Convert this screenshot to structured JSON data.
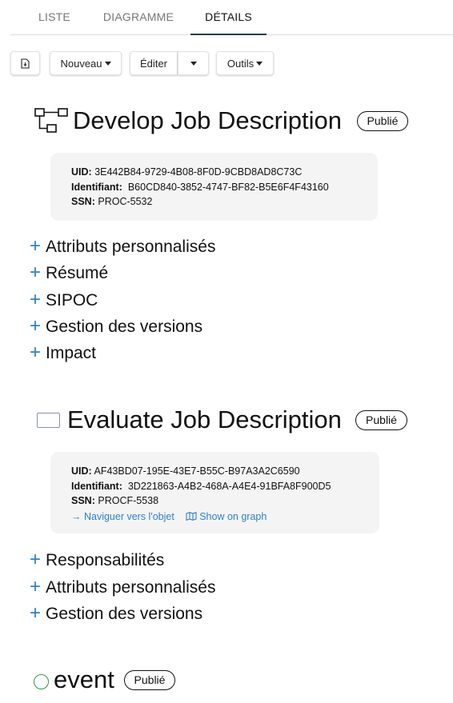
{
  "tabs": [
    {
      "label": "LISTE"
    },
    {
      "label": "DIAGRAMME"
    },
    {
      "label": "DÉTAILS"
    }
  ],
  "toolbar": {
    "file_icon": "file-export-icon",
    "new_label": "Nouveau",
    "edit_label": "Éditer",
    "tools_label": "Outils"
  },
  "objects": [
    {
      "icon": "process-flow-icon",
      "title": "Develop Job Description",
      "status": "Publié",
      "uid_label": "UID:",
      "uid": "3E442B84-9729-4B08-8F0D-9CBD8AD8C73C",
      "id_label": "Identifiant:",
      "id": "B60CD840-3852-4747-BF82-B5E6F4F43160",
      "ssn_label": "SSN:",
      "ssn": "PROC-5532",
      "sections": [
        "Attributs personnalisés",
        "Résumé",
        "SIPOC",
        "Gestion des versions",
        "Impact"
      ]
    },
    {
      "icon": "rectangle-function-icon",
      "title": "Evaluate Job Description",
      "status": "Publié",
      "uid_label": "UID:",
      "uid": "AF43BD07-195E-43E7-B55C-B97A3A2C6590",
      "id_label": "Identifiant:",
      "id": "3D221863-A4B2-468A-A4E4-91BFA8F900D5",
      "ssn_label": "SSN:",
      "ssn": "PROCF-5538",
      "link_navigate": "→ Naviguer vers l'objet",
      "link_graph": "Show on graph",
      "sections": [
        "Responsabilités",
        "Attributs personnalisés",
        "Gestion des versions"
      ]
    },
    {
      "icon": "event-circle-icon",
      "title": "event",
      "status": "Publié"
    }
  ],
  "colors": {
    "accent": "#2f80c8",
    "active_tab_underline": "#1f3a5a",
    "event_green": "#2e9a4a",
    "card_bg": "#f4f4f4"
  }
}
